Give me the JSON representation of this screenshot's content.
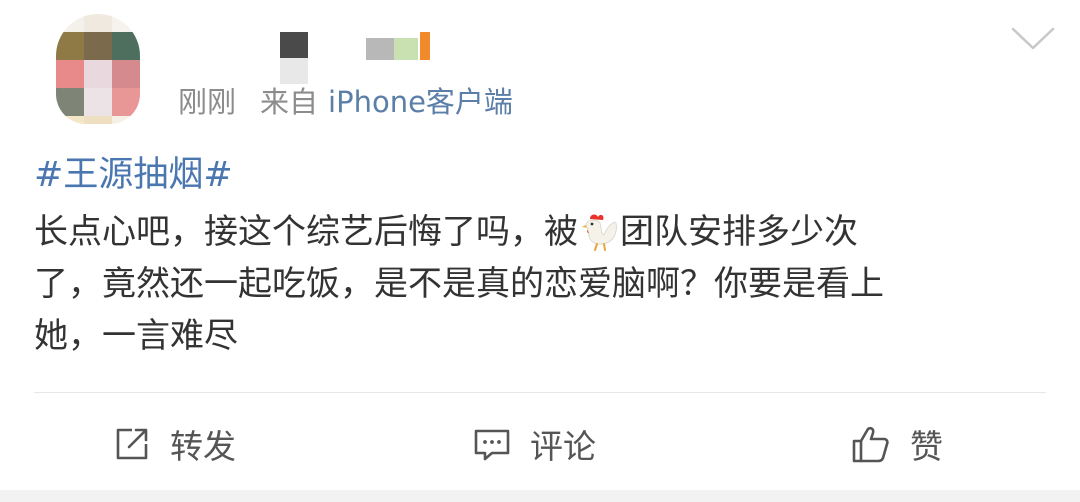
{
  "post": {
    "time": "刚刚",
    "from_label": "来自",
    "source": "iPhone客户端",
    "hashtag": "#王源抽烟#",
    "content_lines": [
      {
        "before": "长点心吧，接这个综艺后悔了吗，被",
        "after": "团队安排多少次"
      },
      "了，竟然还一起吃饭，是不是真的恋爱脑啊？你要是看上",
      "她，一言难尽"
    ],
    "emoji": "rooster"
  },
  "actions": {
    "repost": "转发",
    "comment": "评论",
    "like": "赞"
  },
  "colors": {
    "link": "#4a77b0",
    "source": "#5b7fa8",
    "meta": "#8c8c8c",
    "text": "#333333",
    "action": "#555555"
  },
  "icons": {
    "menu": "chevron-down-icon",
    "repost": "share-icon",
    "comment": "comment-icon",
    "like": "thumbs-up-icon"
  },
  "privacy": "avatar and username pixelated"
}
